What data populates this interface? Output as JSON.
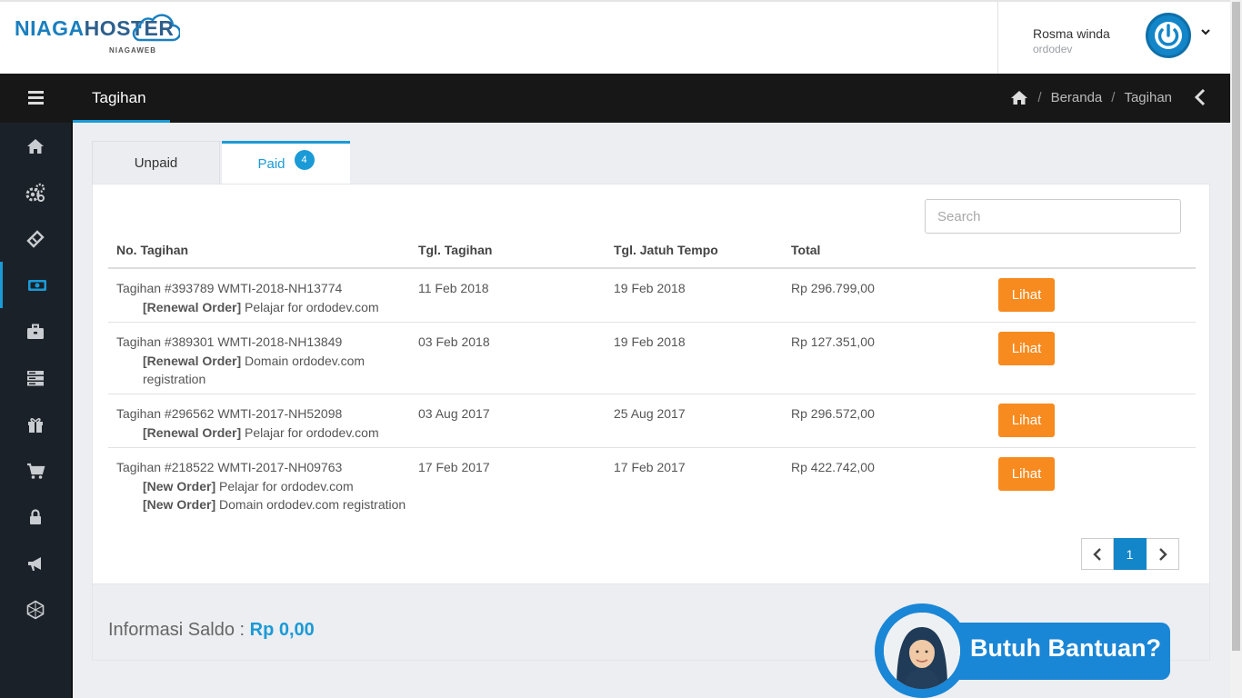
{
  "brand": {
    "name_part1": "NIAGA",
    "name_part2": "HOSTER",
    "sub": "NIAGAWEB"
  },
  "user": {
    "name": "Rosma winda",
    "org": "ordodev"
  },
  "titlebar": {
    "title": "Tagihan",
    "breadcrumb": [
      "Beranda",
      "Tagihan"
    ]
  },
  "sidebar": {
    "items": [
      {
        "icon": "home-icon"
      },
      {
        "icon": "gears-icon"
      },
      {
        "icon": "ticket-icon"
      },
      {
        "icon": "money-icon",
        "active": true
      },
      {
        "icon": "briefcase-icon"
      },
      {
        "icon": "server-icon"
      },
      {
        "icon": "gift-icon"
      },
      {
        "icon": "cart-icon"
      },
      {
        "icon": "lock-icon"
      },
      {
        "icon": "megaphone-icon"
      },
      {
        "icon": "hexagon-icon"
      }
    ]
  },
  "tabs": {
    "unpaid": "Unpaid",
    "paid": "Paid",
    "paid_count": "4"
  },
  "search": {
    "placeholder": "Search",
    "value": ""
  },
  "table": {
    "headers": [
      "No. Tagihan",
      "Tgl. Tagihan",
      "Tgl. Jatuh Tempo",
      "Total"
    ],
    "action_label": "Lihat",
    "rows": [
      {
        "invoice": "Tagihan #393789 WMTI-2018-NH13774",
        "items": [
          {
            "type": "[Renewal Order]",
            "desc": " Pelajar for ordodev.com"
          }
        ],
        "date": "11 Feb 2018",
        "due": "19 Feb 2018",
        "total": "Rp 296.799,00"
      },
      {
        "invoice": "Tagihan #389301 WMTI-2018-NH13849",
        "items": [
          {
            "type": "[Renewal Order]",
            "desc": " Domain ordodev.com registration"
          }
        ],
        "date": "03 Feb 2018",
        "due": "19 Feb 2018",
        "total": "Rp 127.351,00"
      },
      {
        "invoice": "Tagihan #296562 WMTI-2017-NH52098",
        "items": [
          {
            "type": "[Renewal Order]",
            "desc": " Pelajar for ordodev.com"
          }
        ],
        "date": "03 Aug 2017",
        "due": "25 Aug 2017",
        "total": "Rp 296.572,00"
      },
      {
        "invoice": "Tagihan #218522 WMTI-2017-NH09763",
        "items": [
          {
            "type": "[New Order]",
            "desc": " Pelajar for ordodev.com"
          },
          {
            "type": "[New Order]",
            "desc": " Domain ordodev.com registration"
          }
        ],
        "date": "17 Feb 2017",
        "due": "17 Feb 2017",
        "total": "Rp 422.742,00"
      }
    ]
  },
  "pagination": {
    "current": "1"
  },
  "saldo": {
    "label": "Informasi Saldo : ",
    "amount": "Rp 0,00"
  },
  "help": {
    "label": "Butuh Bantuan?"
  },
  "colors": {
    "accent": "#1a9ad6",
    "button": "#f78b1f",
    "sidebar": "#1b2128",
    "titlebar": "#171717"
  }
}
